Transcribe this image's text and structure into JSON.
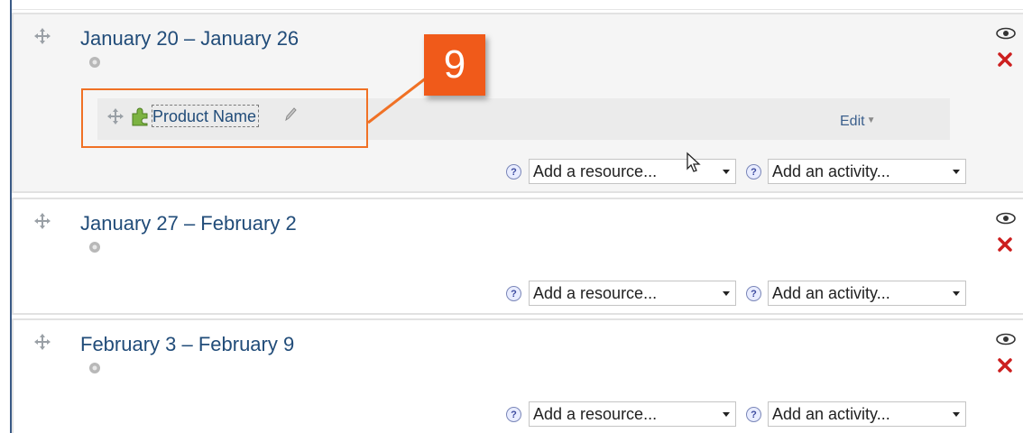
{
  "sections": [
    {
      "title": "January 20 – January 26",
      "add_resource": "Add a resource...",
      "add_activity": "Add an activity...",
      "activity": {
        "name": "Product Name",
        "edit_label": "Edit"
      }
    },
    {
      "title": "January 27 – February 2",
      "add_resource": "Add a resource...",
      "add_activity": "Add an activity..."
    },
    {
      "title": "February 3 – February 9",
      "add_resource": "Add a resource...",
      "add_activity": "Add an activity..."
    }
  ],
  "help_glyph": "?",
  "callout": {
    "number": "9",
    "color": "#f05a1a"
  },
  "colors": {
    "link": "#214c79",
    "delete": "#cc1f1f",
    "left_bar": "#3a5a86"
  }
}
